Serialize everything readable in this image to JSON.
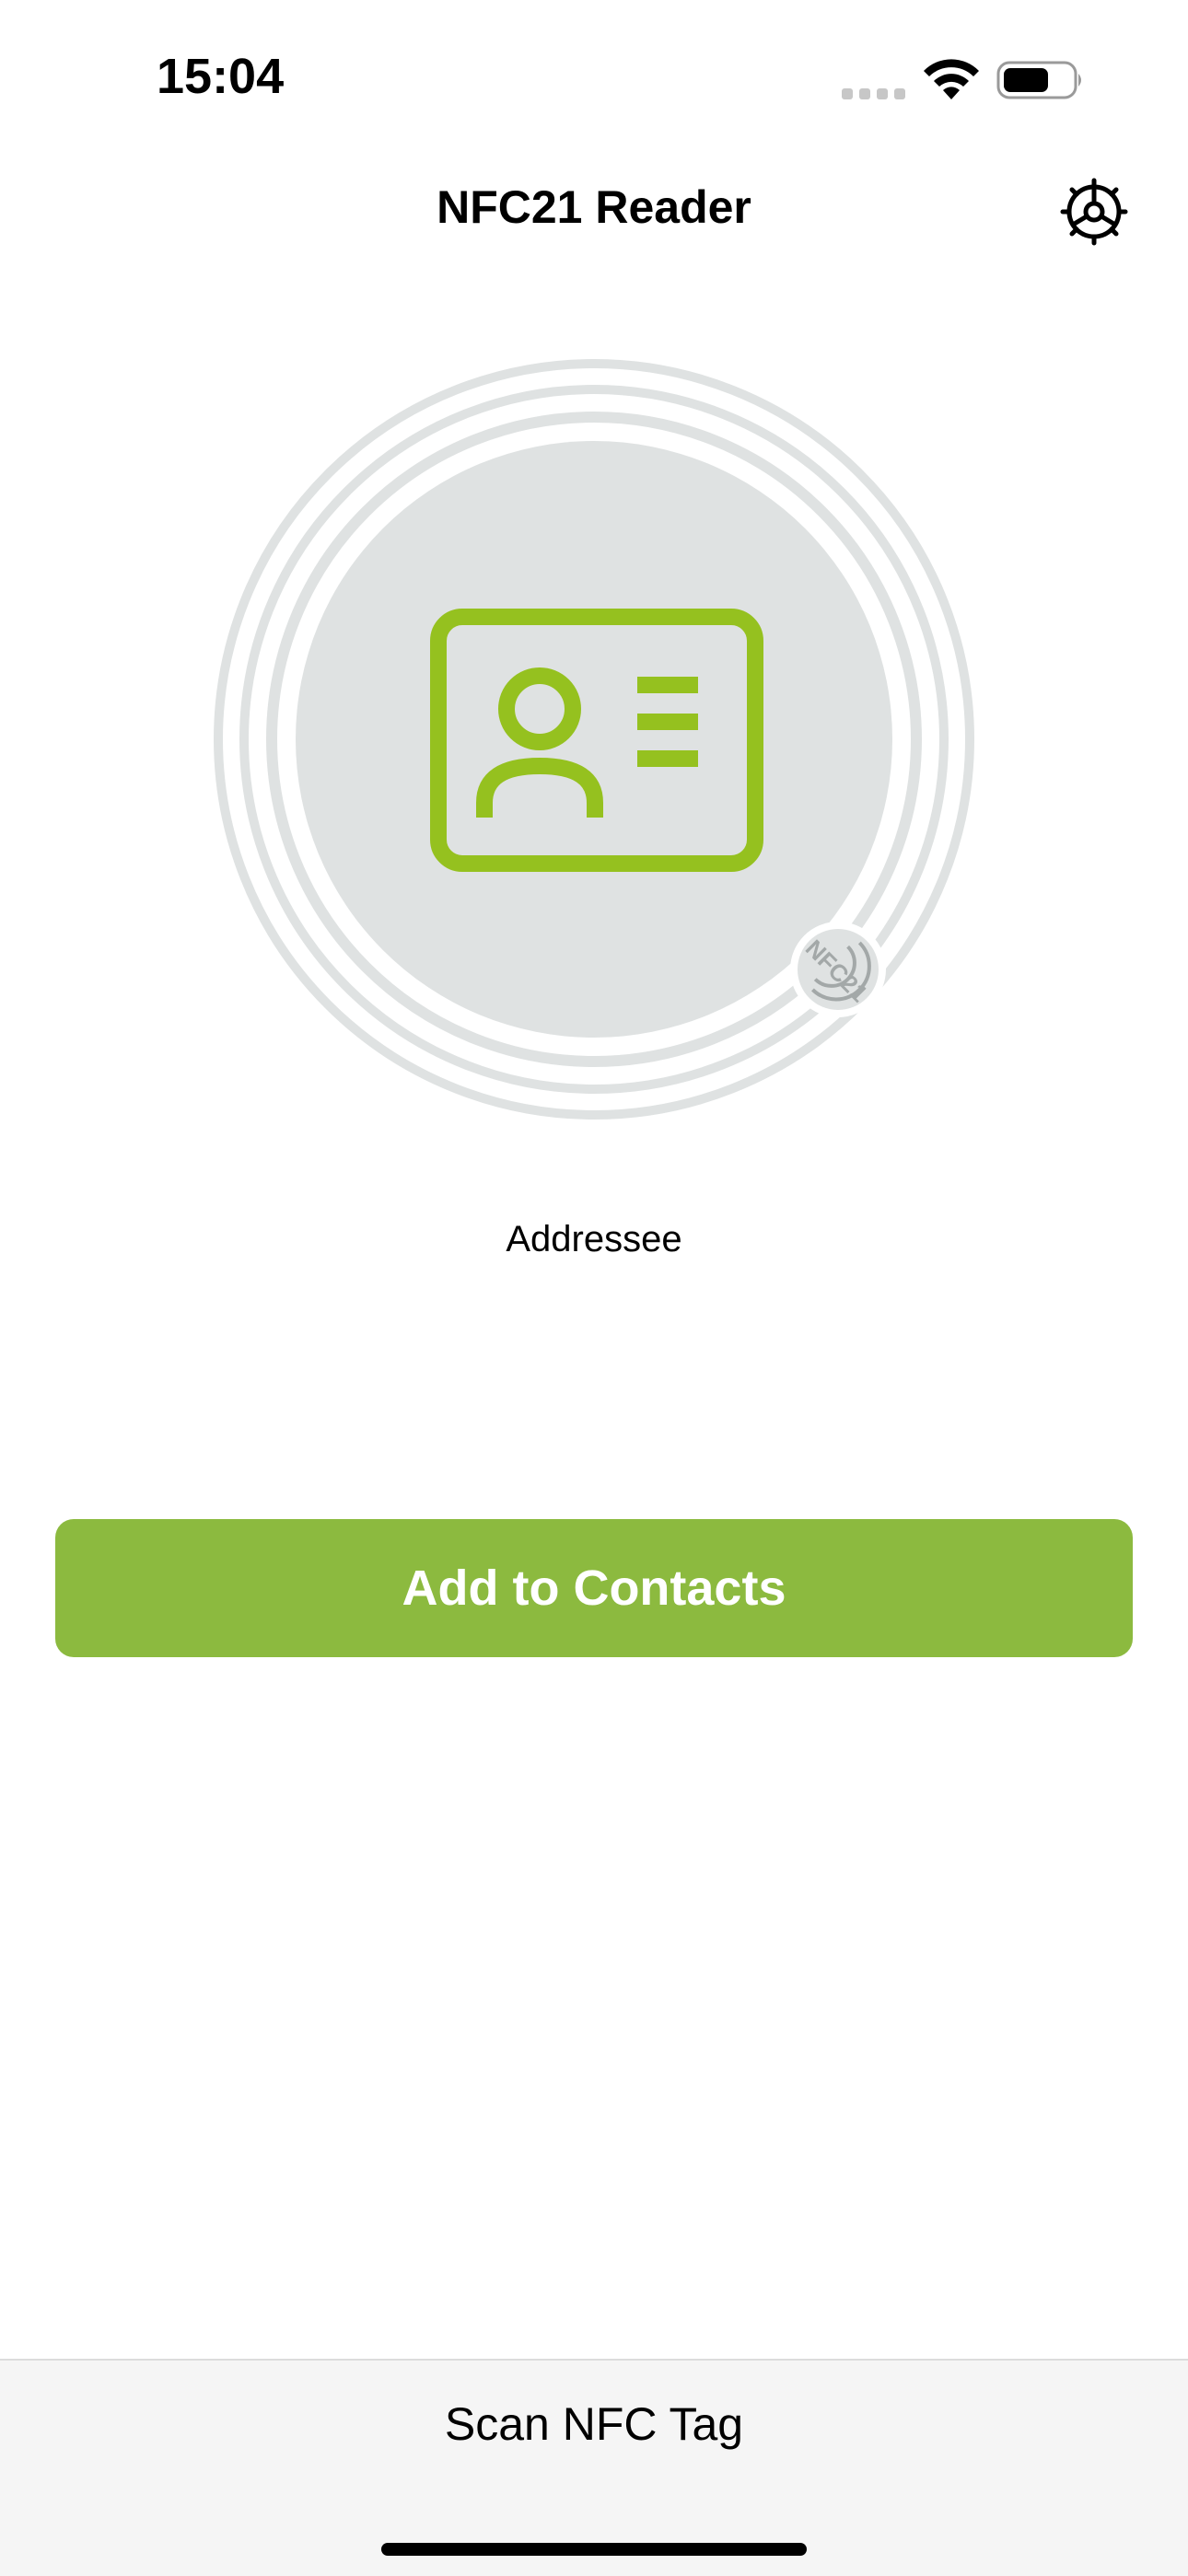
{
  "status_bar": {
    "time": "15:04",
    "icons": [
      "cellular-signal-icon",
      "wifi-icon",
      "battery-icon"
    ]
  },
  "nav": {
    "title": "NFC21 Reader",
    "settings_icon": "gear-icon"
  },
  "hero": {
    "icon": "contact-card-icon",
    "badge_text": "NFC21",
    "accent_color": "#95c11f",
    "circle_color": "#dfe2e2"
  },
  "record": {
    "label": "Addressee"
  },
  "actions": {
    "add_to_contacts_label": "Add to Contacts",
    "button_color": "#8cba3f"
  },
  "bottom_bar": {
    "scan_label": "Scan NFC Tag"
  }
}
